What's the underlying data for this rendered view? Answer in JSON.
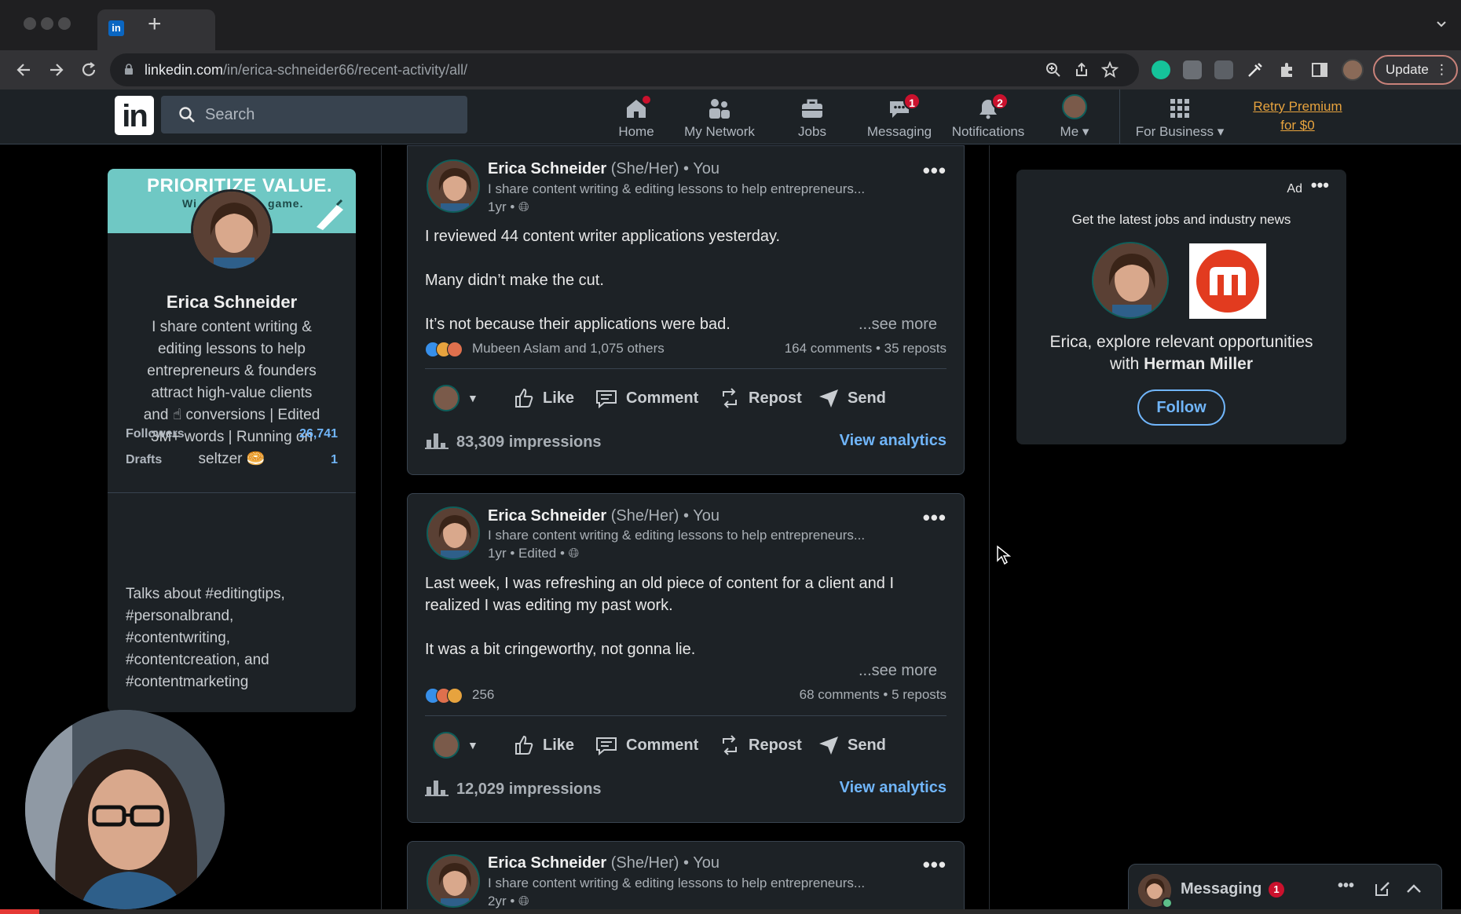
{
  "browser": {
    "url_domain": "linkedin.com",
    "url_path": "/in/erica-schneider66/recent-activity/all/",
    "new_tab": "+",
    "update_label": "Update",
    "tab_favicon": "in"
  },
  "nav": {
    "logo": "in",
    "search_placeholder": "Search",
    "items": [
      {
        "label": "Home",
        "icon": "home-icon",
        "badge": ""
      },
      {
        "label": "My Network",
        "icon": "network-icon",
        "badge": ""
      },
      {
        "label": "Jobs",
        "icon": "briefcase-icon",
        "badge": ""
      },
      {
        "label": "Messaging",
        "icon": "messaging-icon",
        "badge": "1"
      },
      {
        "label": "Notifications",
        "icon": "bell-icon",
        "badge": "2"
      },
      {
        "label": "Me",
        "icon": "avatar",
        "badge": ""
      },
      {
        "label": "For Business",
        "icon": "grid-icon",
        "badge": ""
      }
    ],
    "premium_line1": "Retry Premium",
    "premium_line2": "for $0"
  },
  "profile": {
    "banner_title": "PRIORITIZE VALUE.",
    "banner_sub_left": "Wi",
    "banner_sub_right": "game.",
    "name": "Erica Schneider",
    "headline_1": "I share content writing &",
    "headline_2": "editing lessons to help",
    "headline_3": "entrepreneurs & founders",
    "headline_4": "attract high-value clients",
    "headline_5": "and ☝ conversions | Edited",
    "headline_6": "3M+ words | Running on",
    "headline_7": "seltzer 🥯",
    "followers_label": "Followers",
    "followers_value": "26,741",
    "drafts_label": "Drafts",
    "drafts_value": "1",
    "topics_1": "Talks about #editingtips,",
    "topics_2": "#personalbrand,",
    "topics_3": "#contentwriting,",
    "topics_4": "#contentcreation, and",
    "topics_5": "#contentmarketing"
  },
  "posts": [
    {
      "author": "Erica Schneider",
      "pronouns": "(She/Her) • You",
      "desc": "I share content writing & editing lessons to help entrepreneurs...",
      "meta": "1yr •",
      "line1": "I reviewed 44 content writer applications yesterday.",
      "line2": "Many didn’t make the cut.",
      "line3": "It’s not because their applications were bad.",
      "line4": "",
      "see_more": "...see more",
      "reactions": "Mubeen Aslam and 1,075 others",
      "comments_reposts": "164 comments • 35 reposts",
      "like": "Like",
      "comment": "Comment",
      "repost": "Repost",
      "send": "Send",
      "impressions": "83,309 impressions",
      "view_analytics": "View analytics"
    },
    {
      "author": "Erica Schneider",
      "pronouns": "(She/Her) • You",
      "desc": "I share content writing & editing lessons to help entrepreneurs...",
      "meta": "1yr • Edited •",
      "line1": "Last week, I was refreshing an old piece of content for a client and I",
      "line2": "realized I was editing my past work.",
      "line3": "",
      "line4": "It was a bit cringeworthy, not gonna lie.",
      "see_more": "...see more",
      "reactions": "256",
      "comments_reposts": "68 comments • 5 reposts",
      "like": "Like",
      "comment": "Comment",
      "repost": "Repost",
      "send": "Send",
      "impressions": "12,029 impressions",
      "view_analytics": "View analytics"
    },
    {
      "author": "Erica Schneider",
      "pronouns": "(She/Her) • You",
      "desc": "I share content writing & editing lessons to help entrepreneurs...",
      "meta": "2yr •"
    }
  ],
  "ad": {
    "label": "Ad",
    "top_text": "Get the latest jobs and industry news",
    "text_1": "Erica, explore relevant opportunities",
    "text_2_prefix": "with ",
    "text_2_company": "Herman Miller",
    "follow": "Follow"
  },
  "messaging": {
    "label": "Messaging",
    "badge": "1"
  },
  "colors": {
    "accent_blue": "#70b5f9",
    "badge_red": "#cb112d",
    "premium_gold": "#e7a33e",
    "card_bg": "#1d2226"
  }
}
